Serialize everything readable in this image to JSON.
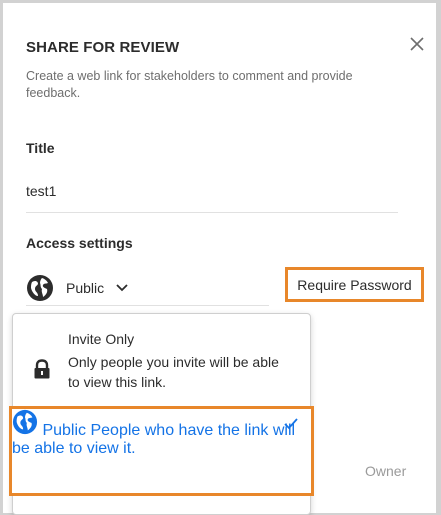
{
  "dialog": {
    "title": "SHARE FOR REVIEW",
    "description": "Create a web link for stakeholders to comment and provide feedback."
  },
  "title_field": {
    "label": "Title",
    "value": "test1"
  },
  "access": {
    "label": "Access settings",
    "selected": "Public",
    "require_password_label": "Require Password"
  },
  "dropdown": {
    "options": [
      {
        "name": "Invite Only",
        "description": "Only people you invite will be able to view this link.",
        "icon": "lock-icon"
      },
      {
        "name": "Public",
        "description": "People who have the link will be able to view it.",
        "icon": "globe-icon",
        "selected": true
      }
    ]
  },
  "owner_label": "Owner",
  "colors": {
    "highlight": "#e8872a",
    "accent": "#1473e6",
    "text": "#2c2c2c",
    "muted": "#6e6e6e"
  }
}
